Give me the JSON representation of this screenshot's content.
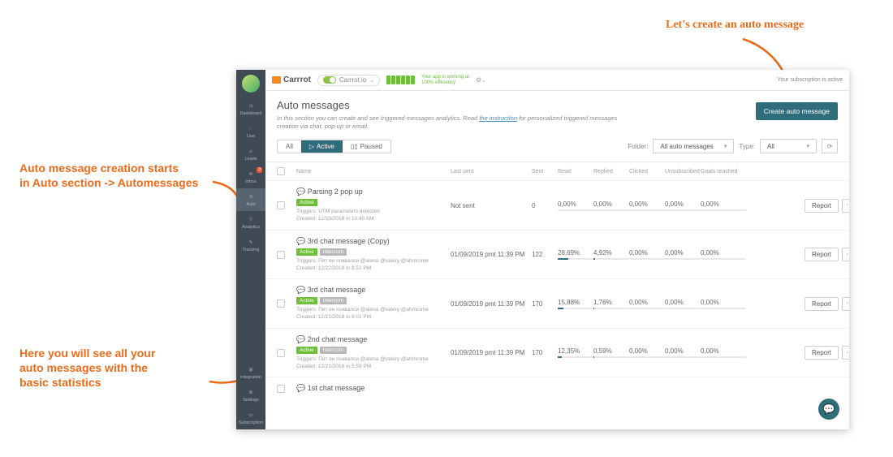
{
  "annotations": {
    "top": "Let's create an auto message",
    "left1a": "Auto message creation starts",
    "left1b": "in Auto section -> Automessages",
    "left2a": "Here you will see all your",
    "left2b": "auto messages with the",
    "left2c": "basic statistics"
  },
  "brand": "Carrrot",
  "app_switch": {
    "name": "Carrrot.io"
  },
  "efficiency": {
    "l1": "Your app is working at",
    "l2": "100% efficiency"
  },
  "subscription": "Your subscription is active",
  "sidebar": {
    "items": [
      "Dashboard",
      "Live",
      "Leads",
      "Inbox",
      "Auto",
      "Analytics",
      "Tracking"
    ],
    "bottom": [
      "Integration",
      "Settings",
      "Subscription"
    ],
    "inbox_badge": "3"
  },
  "page": {
    "title": "Auto messages",
    "desc_pre": "In this section you can create and see triggered messages analytics. Read ",
    "desc_link": "the instruction",
    "desc_post": " for personalized triggered messages creation via chat, pop-up or email.",
    "create_btn": "Create auto message"
  },
  "filters": {
    "all": "All",
    "active": "Active",
    "paused": "Paused",
    "folder_label": "Folder:",
    "folder_value": "All auto messages",
    "type_label": "Type:",
    "type_value": "All"
  },
  "columns": {
    "name": "Name",
    "last_sent": "Last sent",
    "sent": "Sent",
    "read": "Read",
    "replied": "Replied",
    "clicked": "Clicked",
    "unsub": "Unsubscribed",
    "goals": "Goals reached"
  },
  "rows": [
    {
      "name": "Parsing 2 pop up",
      "tags": [
        "Active"
      ],
      "trig": "Triggers: UTM parameters detected",
      "created": "Created: 12/23/2018 in 10:40 AM",
      "last": "Not sent",
      "sent": "0",
      "read": "0,00%",
      "readp": 0,
      "rep": "0,00%",
      "repp": 0,
      "click": "0,00%",
      "clickp": 0,
      "unsub": "0,00%",
      "unsubp": 0,
      "goal": "0,00%",
      "goalp": 0
    },
    {
      "name": "3rd chat message (Copy)",
      "tags": [
        "Active",
        "Intercom"
      ],
      "trig": "Triggers: Пит ен поквалси @alena @valery @ahmrome",
      "created": "Created: 12/22/2018 in 8:51 PM",
      "last": "01/09/2019 pmt 11:39 PM",
      "sent": "122",
      "read": "28,69%",
      "readp": 29,
      "rep": "4,92%",
      "repp": 5,
      "click": "0,00%",
      "clickp": 0,
      "unsub": "0,00%",
      "unsubp": 0,
      "goal": "0,00%",
      "goalp": 0
    },
    {
      "name": "3rd chat message",
      "tags": [
        "Active",
        "Intercom"
      ],
      "trig": "Triggers: Пит ен поквалси @alena @valery @ahmrome",
      "created": "Created: 12/21/2018 in 6:01 PM",
      "last": "01/09/2019 pmt 11:39 PM",
      "sent": "170",
      "read": "15,88%",
      "readp": 16,
      "rep": "1,76%",
      "repp": 2,
      "click": "0,00%",
      "clickp": 0,
      "unsub": "0,00%",
      "unsubp": 0,
      "goal": "0,00%",
      "goalp": 0
    },
    {
      "name": "2nd chat message",
      "tags": [
        "Active",
        "Intercom"
      ],
      "trig": "Triggers: Пит ен поквалси @alena @valery @ahmrome",
      "created": "Created: 12/21/2018 in 5:59 PM",
      "last": "01/09/2019 pmt 11:39 PM",
      "sent": "170",
      "read": "12,35%",
      "readp": 12,
      "rep": "0,59%",
      "repp": 1,
      "click": "0,00%",
      "clickp": 0,
      "unsub": "0,00%",
      "unsubp": 0,
      "goal": "0,00%",
      "goalp": 0
    },
    {
      "name": "1st chat message",
      "tags": [],
      "trig": "",
      "created": "",
      "last": "",
      "sent": "",
      "read": "",
      "readp": 0,
      "rep": "",
      "repp": 0,
      "click": "",
      "clickp": 0,
      "unsub": "",
      "unsubp": 0,
      "goal": "",
      "goalp": 0
    }
  ],
  "btn": {
    "report": "Report"
  }
}
